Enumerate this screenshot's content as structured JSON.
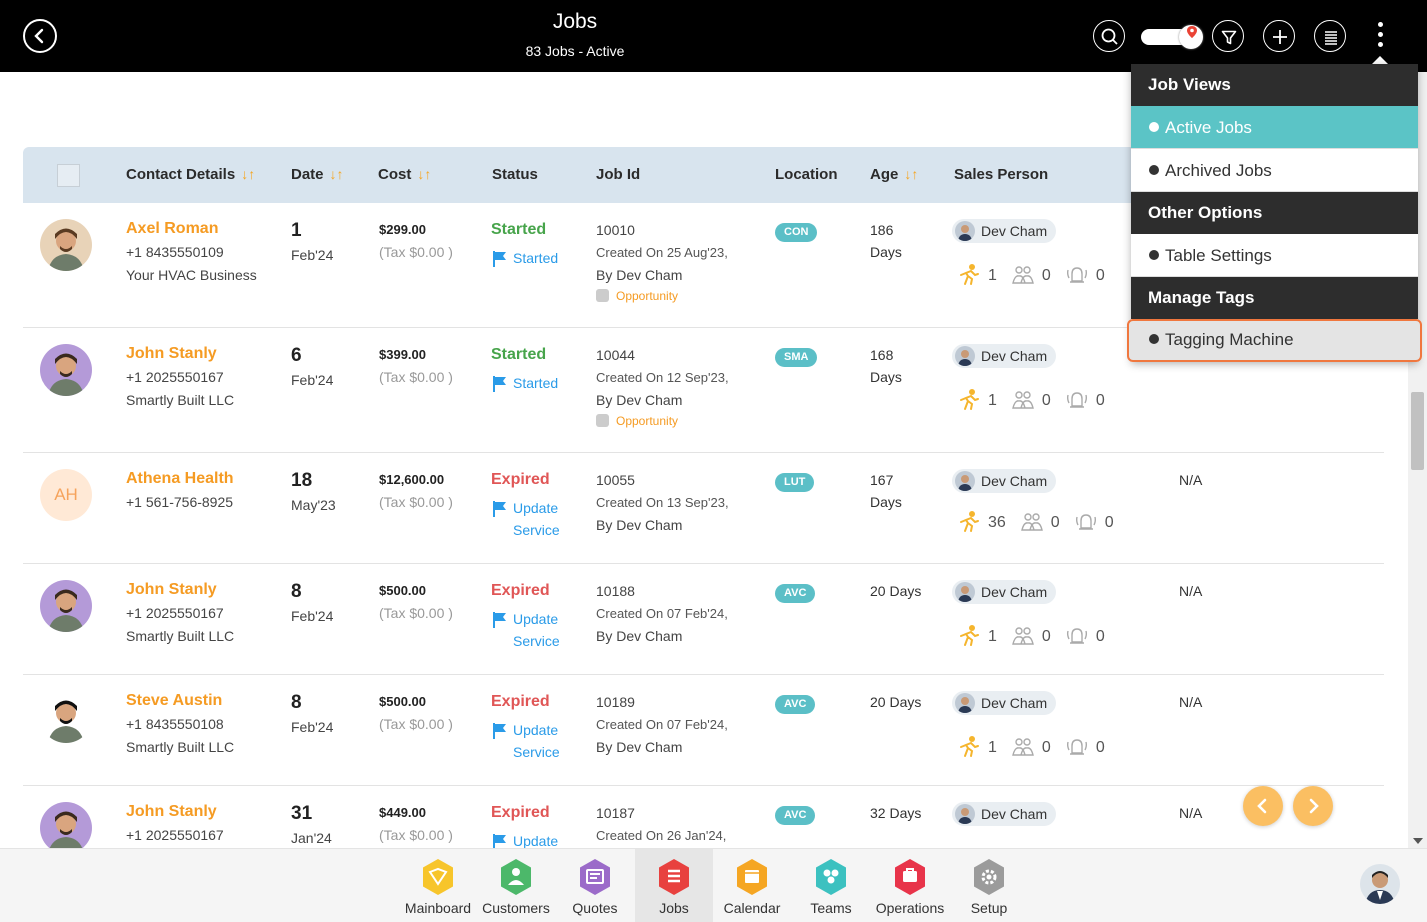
{
  "header": {
    "title": "Jobs",
    "subtitle": "83 Jobs - Active"
  },
  "table": {
    "headers": {
      "contact": "Contact Details",
      "date": "Date",
      "cost": "Cost",
      "status": "Status",
      "job_id": "Job Id",
      "location": "Location",
      "age": "Age",
      "sales": "Sales Person"
    },
    "rows": [
      {
        "name": "Axel Roman",
        "phone": "+1 8435550109",
        "company": "Your HVAC Business",
        "day": "1",
        "month": "Feb'24",
        "cost": "$299.00",
        "tax": "(Tax $0.00 )",
        "status": "Started",
        "sub1": "Started",
        "sub2": "",
        "job_id": "10010",
        "created": "Created On 25 Aug'23,",
        "by": "By Dev Cham",
        "opp": "Opportunity",
        "loc": "CON",
        "age1": "186",
        "age2": "Days",
        "sales": "Dev Cham",
        "c1": "1",
        "c2": "0",
        "c3": "0",
        "na": ""
      },
      {
        "name": "John Stanly",
        "phone": "+1 2025550167",
        "company": "Smartly Built LLC",
        "day": "6",
        "month": "Feb'24",
        "cost": "$399.00",
        "tax": "(Tax $0.00 )",
        "status": "Started",
        "sub1": "Started",
        "sub2": "",
        "job_id": "10044",
        "created": "Created On 12 Sep'23,",
        "by": "By Dev Cham",
        "opp": "Opportunity",
        "loc": "SMA",
        "age1": "168",
        "age2": "Days",
        "sales": "Dev Cham",
        "c1": "1",
        "c2": "0",
        "c3": "0",
        "na": ""
      },
      {
        "initials": "AH",
        "name": "Athena Health",
        "phone": "+1 561-756-8925",
        "company": "",
        "day": "18",
        "month": "May'23",
        "cost": "$12,600.00",
        "tax": "(Tax $0.00 )",
        "status": "Expired",
        "sub1": "Update",
        "sub2": "Service",
        "job_id": "10055",
        "created": "Created On 13 Sep'23,",
        "by": "By Dev Cham",
        "opp": "",
        "loc": "LUT",
        "age1": "167",
        "age2": "Days",
        "sales": "Dev Cham",
        "c1": "36",
        "c2": "0",
        "c3": "0",
        "na": "N/A"
      },
      {
        "name": "John Stanly",
        "phone": "+1 2025550167",
        "company": "Smartly Built LLC",
        "day": "8",
        "month": "Feb'24",
        "cost": "$500.00",
        "tax": "(Tax $0.00 )",
        "status": "Expired",
        "sub1": "Update",
        "sub2": "Service",
        "job_id": "10188",
        "created": "Created On 07 Feb'24,",
        "by": "By Dev Cham",
        "opp": "",
        "loc": "AVC",
        "age1": "20 Days",
        "age2": "",
        "sales": "Dev Cham",
        "c1": "1",
        "c2": "0",
        "c3": "0",
        "na": "N/A"
      },
      {
        "name": "Steve Austin",
        "phone": "+1 8435550108",
        "company": "Smartly Built LLC",
        "day": "8",
        "month": "Feb'24",
        "cost": "$500.00",
        "tax": "(Tax $0.00 )",
        "status": "Expired",
        "sub1": "Update",
        "sub2": "Service",
        "job_id": "10189",
        "created": "Created On 07 Feb'24,",
        "by": "By Dev Cham",
        "opp": "",
        "loc": "AVC",
        "age1": "20 Days",
        "age2": "",
        "sales": "Dev Cham",
        "c1": "1",
        "c2": "0",
        "c3": "0",
        "na": "N/A"
      },
      {
        "name": "John Stanly",
        "phone": "+1 2025550167",
        "company": "",
        "day": "31",
        "month": "Jan'24",
        "cost": "$449.00",
        "tax": "(Tax $0.00 )",
        "status": "Expired",
        "sub1": "Update",
        "sub2": "",
        "job_id": "10187",
        "created": "Created On 26 Jan'24,",
        "by": "",
        "opp": "",
        "loc": "AVC",
        "age1": "32 Days",
        "age2": "",
        "sales": "Dev Cham",
        "c1": "",
        "c2": "",
        "c3": "",
        "na": "N/A"
      }
    ]
  },
  "menu": {
    "h1": "Job Views",
    "active_jobs": "Active Jobs",
    "archived_jobs": "Archived Jobs",
    "h2": "Other Options",
    "table_settings": "Table Settings",
    "h3": "Manage Tags",
    "tagging_machine": "Tagging Machine"
  },
  "nav": [
    {
      "label": "Mainboard",
      "color": "#f7c52b",
      "icon": "mainboard-icon"
    },
    {
      "label": "Customers",
      "color": "#4cb86a",
      "icon": "customers-icon"
    },
    {
      "label": "Quotes",
      "color": "#9b6bc9",
      "icon": "quotes-icon"
    },
    {
      "label": "Jobs",
      "color": "#e8413f",
      "icon": "jobs-icon"
    },
    {
      "label": "Calendar",
      "color": "#f5a623",
      "icon": "calendar-icon"
    },
    {
      "label": "Teams",
      "color": "#3cc1c0",
      "icon": "teams-icon"
    },
    {
      "label": "Operations",
      "color": "#e8344a",
      "icon": "operations-icon"
    },
    {
      "label": "Setup",
      "color": "#9b9b9b",
      "icon": "setup-icon"
    }
  ],
  "colors": {
    "accent": "#f59b23",
    "header": "#000000",
    "menu_active": "#5bc4c6",
    "started": "#47a44b",
    "expired": "#e05656",
    "location_badge": "#5bbfc7"
  }
}
